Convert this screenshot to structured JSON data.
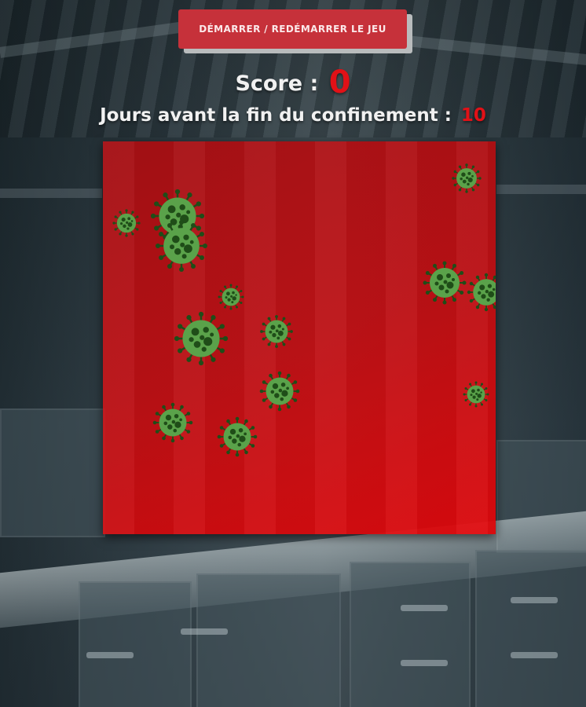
{
  "controls": {
    "start_button_label": "DÉMARRER / REDÉMARRER LE JEU"
  },
  "score": {
    "label": "Score :",
    "value": "0"
  },
  "days": {
    "label": "Jours avant la fin du confinement :",
    "value": "10"
  },
  "colors": {
    "accent": "#e11117",
    "button": "#c6313a",
    "virus_body": "#5aa24a",
    "virus_dots": "#1f4d18"
  },
  "game": {
    "virus_icon": "coronavirus-icon",
    "virus_count": 15
  }
}
